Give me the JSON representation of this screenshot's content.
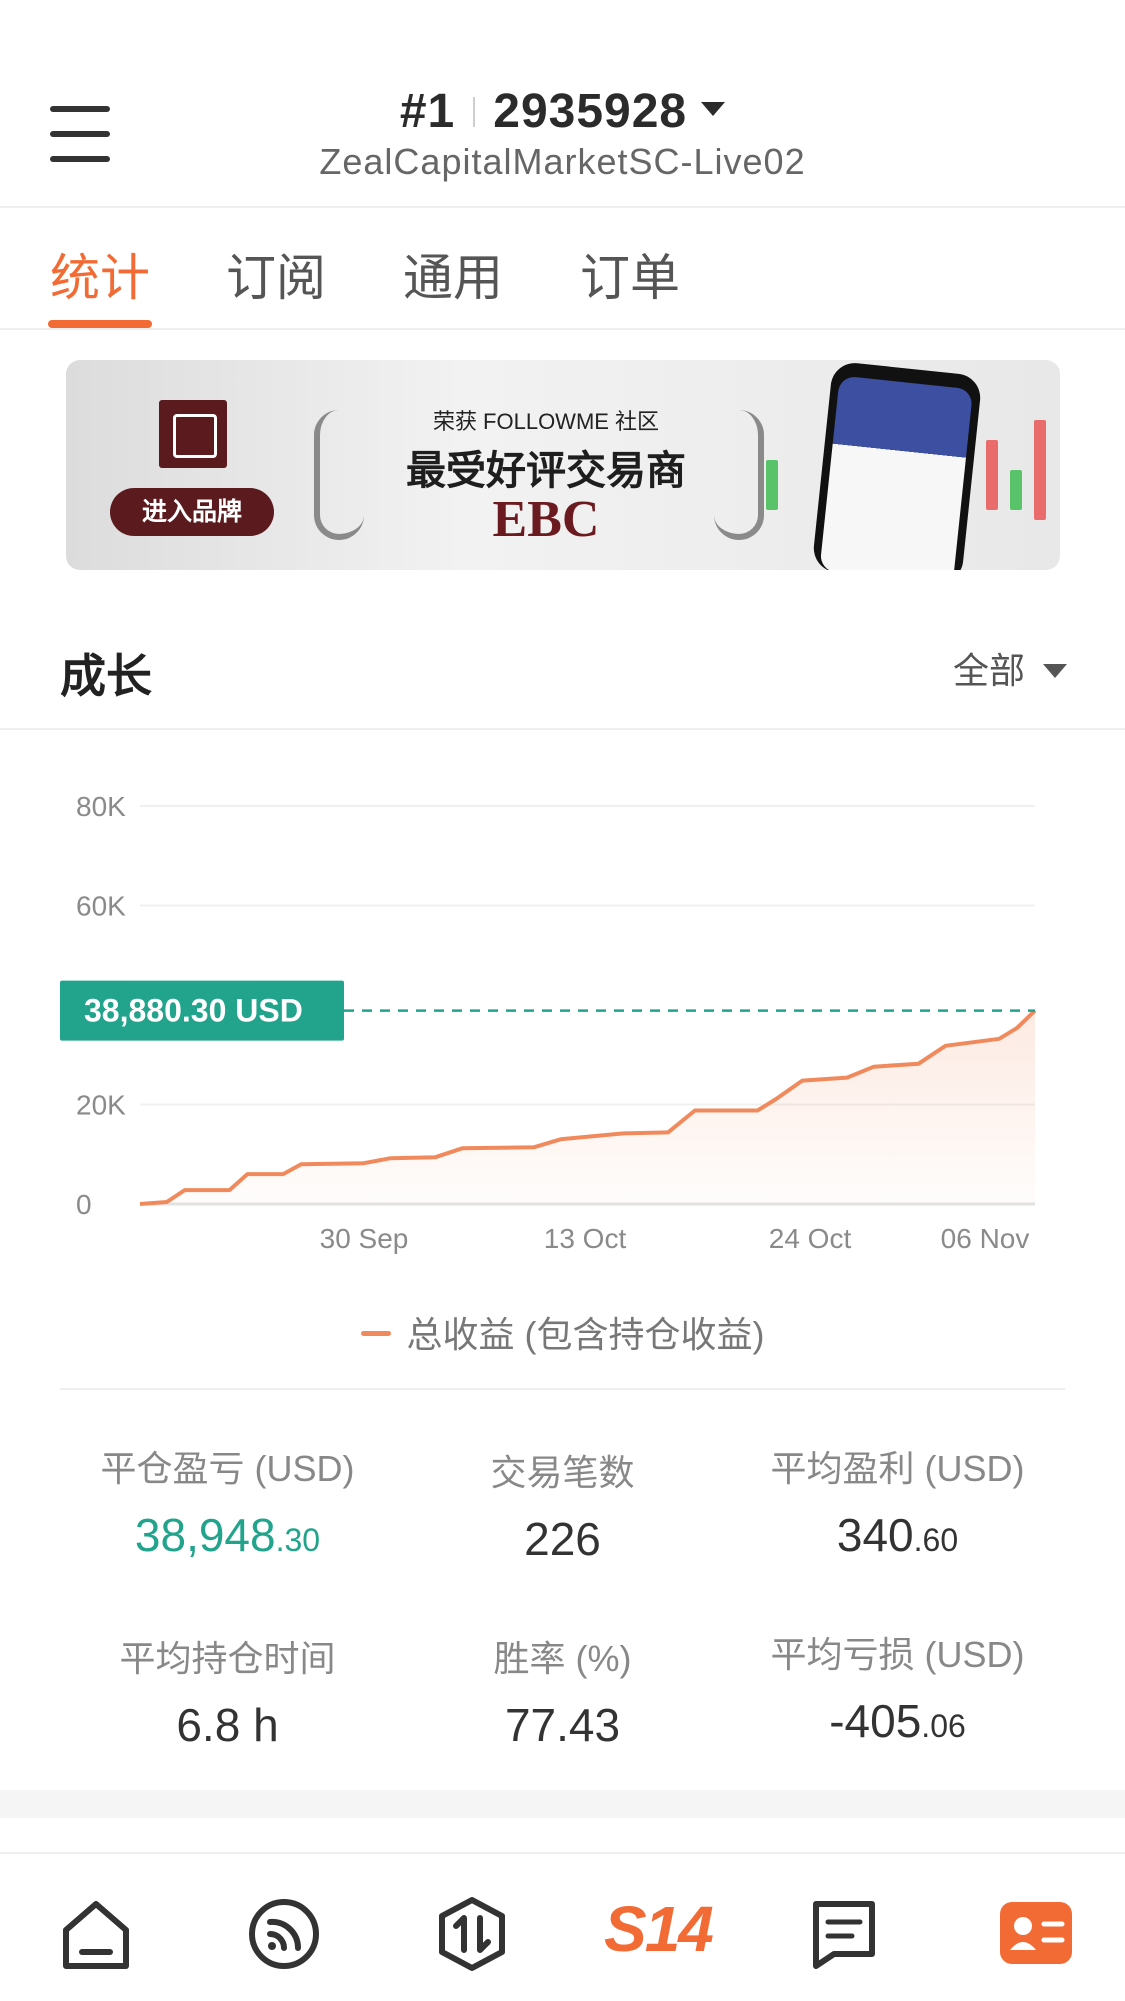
{
  "header": {
    "rank": "#1",
    "account_id": "2935928",
    "server": "ZealCapitalMarketSC-Live02"
  },
  "tabs": [
    {
      "label": "统计",
      "active": true
    },
    {
      "label": "订阅",
      "active": false
    },
    {
      "label": "通用",
      "active": false
    },
    {
      "label": "订单",
      "active": false
    }
  ],
  "banner": {
    "brand_button": "进入品牌",
    "award_small": "荣获 FOLLOWME 社区",
    "award_title": "最受好评交易商",
    "award_brand": "EBC"
  },
  "growth": {
    "title": "成长",
    "range": "全部"
  },
  "chart_data": {
    "type": "area",
    "y_ticks": [
      "80K",
      "60K",
      "20K",
      "0"
    ],
    "x_ticks": [
      "30 Sep",
      "13 Oct",
      "24 Oct",
      "06 Nov"
    ],
    "ylim": [
      0,
      80000
    ],
    "current_label": "38,880.30 USD",
    "current_value": 38880.3,
    "legend": "总收益 (包含持仓收益)",
    "series": [
      {
        "name": "总收益 (包含持仓收益)",
        "color": "#f08a5d",
        "points": [
          [
            0.0,
            0
          ],
          [
            0.03,
            400
          ],
          [
            0.05,
            2800
          ],
          [
            0.1,
            2800
          ],
          [
            0.12,
            6000
          ],
          [
            0.16,
            6000
          ],
          [
            0.18,
            8000
          ],
          [
            0.25,
            8200
          ],
          [
            0.28,
            9200
          ],
          [
            0.33,
            9400
          ],
          [
            0.36,
            11200
          ],
          [
            0.44,
            11400
          ],
          [
            0.47,
            13000
          ],
          [
            0.54,
            14200
          ],
          [
            0.59,
            14400
          ],
          [
            0.62,
            18800
          ],
          [
            0.69,
            18800
          ],
          [
            0.71,
            21000
          ],
          [
            0.74,
            24800
          ],
          [
            0.79,
            25400
          ],
          [
            0.82,
            27600
          ],
          [
            0.87,
            28200
          ],
          [
            0.9,
            31800
          ],
          [
            0.96,
            33200
          ],
          [
            0.98,
            35400
          ],
          [
            1.0,
            38880
          ]
        ]
      }
    ]
  },
  "stats": [
    {
      "label": "平仓盈亏 (USD)",
      "int": "38,948",
      "frac": ".30",
      "green": true
    },
    {
      "label": "交易笔数",
      "int": "226",
      "frac": "",
      "green": false
    },
    {
      "label": "平均盈利 (USD)",
      "int": "340",
      "frac": ".60",
      "green": false
    },
    {
      "label": "平均持仓时间",
      "int": "6.8 h",
      "frac": "",
      "green": false
    },
    {
      "label": "胜率 (%)",
      "int": "77.43",
      "frac": "",
      "green": false
    },
    {
      "label": "平均亏损 (USD)",
      "int": "-405",
      "frac": ".06",
      "green": false
    }
  ],
  "nav": {
    "s14": "S14"
  },
  "colors": {
    "accent": "#f26b34",
    "green": "#21a48b",
    "line": "#f08a5d"
  }
}
